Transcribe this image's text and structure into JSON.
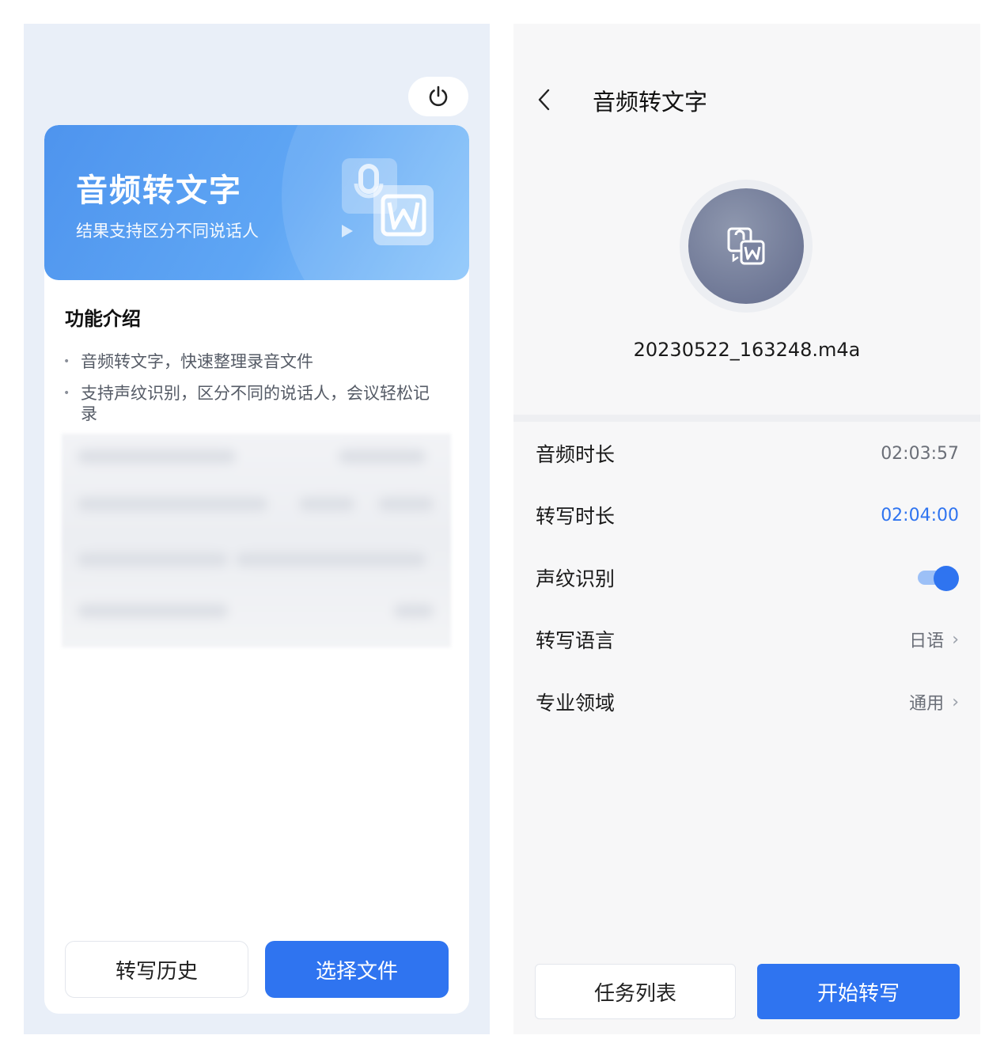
{
  "left": {
    "hero": {
      "title": "音频转文字",
      "subtitle": "结果支持区分不同说话人"
    },
    "intro": {
      "title": "功能介绍",
      "items": [
        "音频转文字，快速整理录音文件",
        "支持声纹识别，区分不同的说话人，会议轻松记录"
      ]
    },
    "buttons": {
      "history": "转写历史",
      "choose": "选择文件"
    }
  },
  "right": {
    "header": {
      "back": "<",
      "title": "音频转文字"
    },
    "file": {
      "name": "20230522_163248.m4a"
    },
    "settings": [
      {
        "label": "音频时长",
        "value": "02:03:57"
      },
      {
        "label": "转写时长",
        "value": "02:04:00"
      },
      {
        "label": "声纹识别",
        "toggle_on": true
      },
      {
        "label": "转写语言",
        "value": "日语"
      },
      {
        "label": "专业领域",
        "value": "通用"
      }
    ],
    "buttons": {
      "tasks": "任务列表",
      "start": "开始转写"
    }
  },
  "colors": {
    "accent": "#2f74f0",
    "hero_gradient_start": "#4e94ee",
    "hero_gradient_end": "#8cc6fb",
    "left_bg": "#e9eff8",
    "right_bg": "#f7f7f8"
  },
  "icons": {
    "power": "power-icon",
    "back": "chevron-left-icon",
    "audio_to_text": "audio-to-word-icon",
    "chevron": "chevron-right-icon"
  }
}
